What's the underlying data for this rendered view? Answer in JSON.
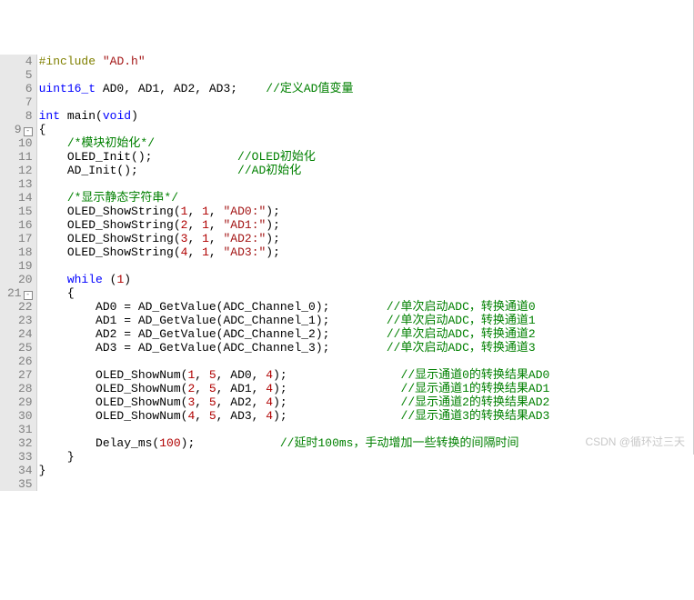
{
  "watermark": "CSDN @循环过三天",
  "lines": [
    {
      "num": 4,
      "html": "<span class='pp'>#include</span> <span class='str'>\"AD.h\"</span>"
    },
    {
      "num": 5,
      "html": ""
    },
    {
      "num": 6,
      "html": "<span class='type'>uint16_t</span> AD0, AD1, AD2, AD3;    <span class='cmt'>//定义AD值变量</span>"
    },
    {
      "num": 7,
      "html": ""
    },
    {
      "num": 8,
      "html": "<span class='type'>int</span> <span class='fn'>main</span>(<span class='kw'>void</span>)"
    },
    {
      "num": 9,
      "fold": "-",
      "html": "{"
    },
    {
      "num": 10,
      "html": "    <span class='cmt'>/*模块初始化*/</span>"
    },
    {
      "num": 11,
      "html": "    OLED_Init();            <span class='cmt'>//OLED初始化</span>"
    },
    {
      "num": 12,
      "html": "    AD_Init();              <span class='cmt'>//AD初始化</span>"
    },
    {
      "num": 13,
      "html": "    "
    },
    {
      "num": 14,
      "html": "    <span class='cmt'>/*显示静态字符串*/</span>"
    },
    {
      "num": 15,
      "html": "    OLED_ShowString(<span class='num'>1</span>, <span class='num'>1</span>, <span class='str'>\"AD0:\"</span>);"
    },
    {
      "num": 16,
      "html": "    OLED_ShowString(<span class='num'>2</span>, <span class='num'>1</span>, <span class='str'>\"AD1:\"</span>);"
    },
    {
      "num": 17,
      "html": "    OLED_ShowString(<span class='num'>3</span>, <span class='num'>1</span>, <span class='str'>\"AD2:\"</span>);"
    },
    {
      "num": 18,
      "html": "    OLED_ShowString(<span class='num'>4</span>, <span class='num'>1</span>, <span class='str'>\"AD3:\"</span>);"
    },
    {
      "num": 19,
      "html": "    "
    },
    {
      "num": 20,
      "html": "    <span class='kw'>while</span> (<span class='num'>1</span>)"
    },
    {
      "num": 21,
      "fold": "-",
      "html": "    {"
    },
    {
      "num": 22,
      "html": "        AD0 = AD_GetValue(ADC_Channel_0);        <span class='cmt'>//单次启动ADC，转换通道0</span>"
    },
    {
      "num": 23,
      "html": "        AD1 = AD_GetValue(ADC_Channel_1);        <span class='cmt'>//单次启动ADC，转换通道1</span>"
    },
    {
      "num": 24,
      "html": "        AD2 = AD_GetValue(ADC_Channel_2);        <span class='cmt'>//单次启动ADC，转换通道2</span>"
    },
    {
      "num": 25,
      "html": "        AD3 = AD_GetValue(ADC_Channel_3);        <span class='cmt'>//单次启动ADC，转换通道3</span>"
    },
    {
      "num": 26,
      "html": "        "
    },
    {
      "num": 27,
      "html": "        OLED_ShowNum(<span class='num'>1</span>, <span class='num'>5</span>, AD0, <span class='num'>4</span>);                <span class='cmt'>//显示通道0的转换结果AD0</span>"
    },
    {
      "num": 28,
      "html": "        OLED_ShowNum(<span class='num'>2</span>, <span class='num'>5</span>, AD1, <span class='num'>4</span>);                <span class='cmt'>//显示通道1的转换结果AD1</span>"
    },
    {
      "num": 29,
      "html": "        OLED_ShowNum(<span class='num'>3</span>, <span class='num'>5</span>, AD2, <span class='num'>4</span>);                <span class='cmt'>//显示通道2的转换结果AD2</span>"
    },
    {
      "num": 30,
      "html": "        OLED_ShowNum(<span class='num'>4</span>, <span class='num'>5</span>, AD3, <span class='num'>4</span>);                <span class='cmt'>//显示通道3的转换结果AD3</span>"
    },
    {
      "num": 31,
      "html": "        "
    },
    {
      "num": 32,
      "html": "        Delay_ms(<span class='num'>100</span>);            <span class='cmt'>//延时100ms，手动增加一些转换的间隔时间</span>"
    },
    {
      "num": 33,
      "html": "    }"
    },
    {
      "num": 34,
      "html": "}"
    },
    {
      "num": 35,
      "html": ""
    }
  ]
}
